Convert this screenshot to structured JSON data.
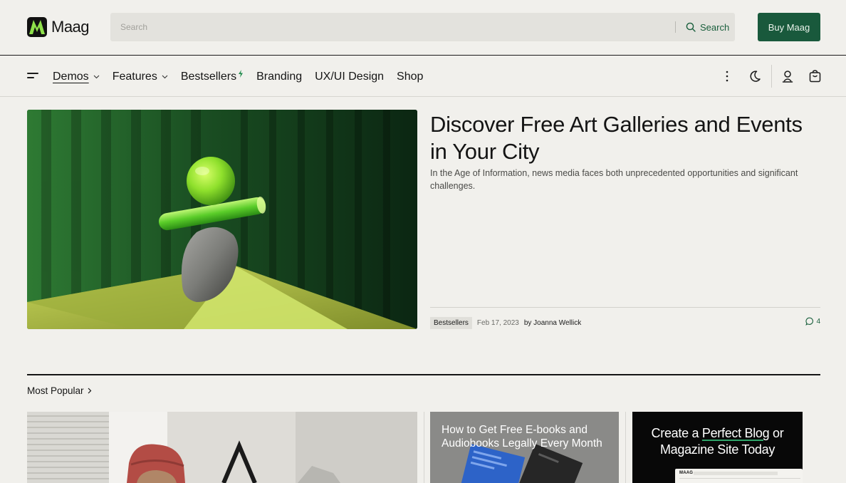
{
  "header": {
    "logo_text": "Maag",
    "search_placeholder": "Search",
    "search_button": "Search",
    "buy_button": "Buy Maag"
  },
  "nav": {
    "items": [
      {
        "label": "Demos",
        "active": true,
        "dropdown": true
      },
      {
        "label": "Features",
        "dropdown": true
      },
      {
        "label": "Bestsellers",
        "badge": "bolt-icon"
      },
      {
        "label": "Branding"
      },
      {
        "label": "UX/UI Design"
      },
      {
        "label": "Shop"
      }
    ],
    "icons": [
      "more-vertical-icon",
      "moon-icon",
      "user-icon",
      "shopping-bag-icon"
    ]
  },
  "hero": {
    "title": "Discover Free Art Galleries and Events in Your City",
    "description": "In the Age of Information, news media faces both unprecedented opportunities and significant challenges.",
    "tag": "Bestsellers",
    "date": "Feb 17, 2023",
    "byline": "by Joanna Wellick",
    "comments": "4"
  },
  "section": {
    "title": "Most Popular"
  },
  "cards": {
    "card2_title": "How to Get Free E-books and Audiobooks Legally Every Month",
    "card3_title_before": "Create a ",
    "card3_title_highlight": "Perfect Blog",
    "card3_title_after": " or Magazine Site Today",
    "card3_mini_logo": "MAAG"
  },
  "colors": {
    "accent": "#19593c",
    "background": "#f1f0ec",
    "logo_green": "#8ee04a"
  }
}
